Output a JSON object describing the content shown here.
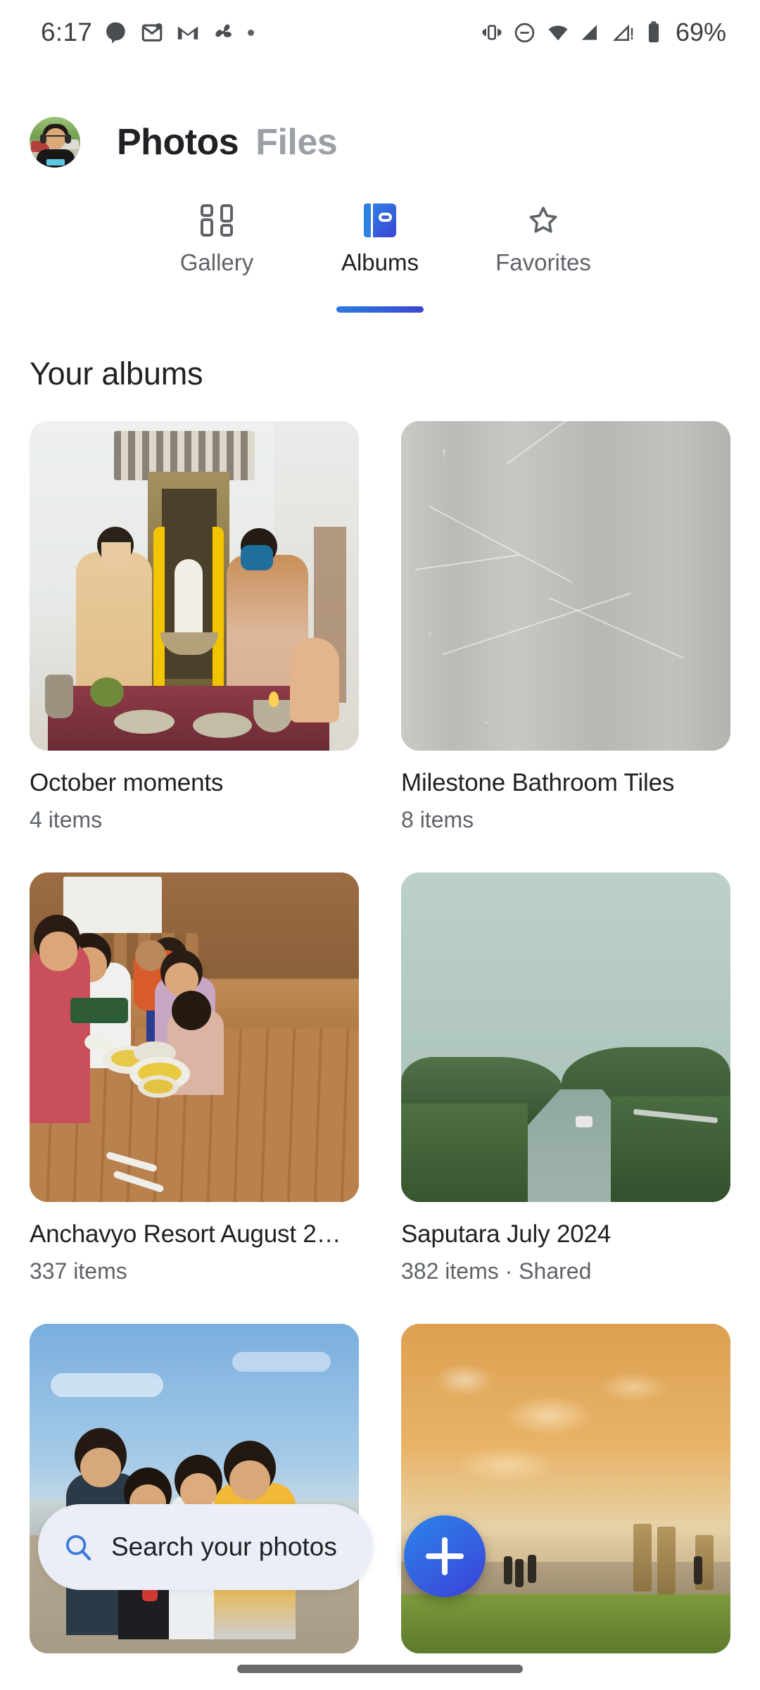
{
  "status_bar": {
    "time": "6:17",
    "battery_text": "69%",
    "left_icons": [
      "chat-bubble-icon",
      "mail-open-icon",
      "gmail-icon",
      "pinwheel-icon",
      "dot-icon"
    ],
    "right_icons": [
      "vibrate-icon",
      "do-not-disturb-icon",
      "wifi-icon",
      "signal-bars-icon",
      "signal-off-icon",
      "battery-icon"
    ]
  },
  "header": {
    "avatar_name": "user-avatar",
    "title_active": "Photos",
    "title_inactive": "Files"
  },
  "tabs": [
    {
      "label": "Gallery",
      "icon": "grid-icon",
      "active": false
    },
    {
      "label": "Albums",
      "icon": "album-book-icon",
      "active": true
    },
    {
      "label": "Favorites",
      "icon": "star-icon",
      "active": false
    }
  ],
  "section": {
    "title": "Your albums"
  },
  "albums": [
    {
      "name": "October moments",
      "meta": "4 items",
      "thumb": "puja-ceremony-photo"
    },
    {
      "name": "Milestone Bathroom Tiles",
      "meta": "8 items",
      "thumb": "gray-marble-tile-photo"
    },
    {
      "name": "Anchavyo Resort August 2…",
      "meta": "337 items",
      "thumb": "family-dining-table-photo"
    },
    {
      "name": "Saputara July 2024",
      "meta": "382 items · Shared",
      "thumb": "misty-green-road-photo"
    },
    {
      "name": "",
      "meta": "",
      "thumb": "beach-friends-group-photo"
    },
    {
      "name": "",
      "meta": "",
      "thumb": "sunset-pier-beach-photo"
    }
  ],
  "search": {
    "placeholder": "Search your photos",
    "icon": "search-icon"
  },
  "fab": {
    "icon": "plus-icon",
    "label": "Create"
  },
  "colors": {
    "accent_blue_start": "#2a85ea",
    "accent_blue_end": "#3a3fd8",
    "text_primary": "#202124",
    "text_secondary": "#5f6368",
    "search_bg": "#eceef7"
  }
}
